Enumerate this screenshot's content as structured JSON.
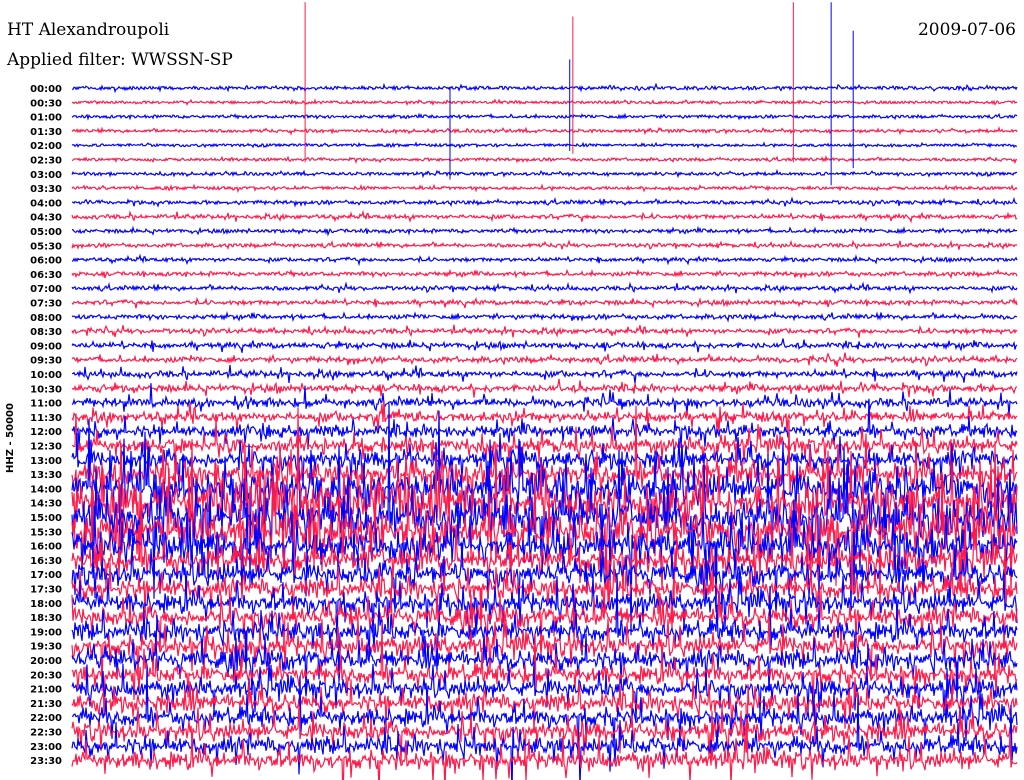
{
  "header": {
    "station": "HT Alexandroupoli",
    "filter_label": "Applied filter: WWSSN-SP",
    "date": "2009-07-06"
  },
  "chart_data": {
    "type": "line",
    "subtype": "helicorder",
    "title": "HT Alexandroupoli",
    "ylabel": "HHZ - 50000",
    "minutes_per_row": 30,
    "colors": {
      "even_row": "#0000ff",
      "odd_row": "#ff1a4a"
    },
    "rows": [
      {
        "label": "00:00",
        "activity": 0.04
      },
      {
        "label": "00:30",
        "activity": 0.02
      },
      {
        "label": "01:00",
        "activity": 0.03
      },
      {
        "label": "01:30",
        "activity": 0.03
      },
      {
        "label": "02:00",
        "activity": 0.02
      },
      {
        "label": "02:30",
        "activity": 0.03
      },
      {
        "label": "03:00",
        "activity": 0.03
      },
      {
        "label": "03:30",
        "activity": 0.03
      },
      {
        "label": "04:00",
        "activity": 0.05
      },
      {
        "label": "04:30",
        "activity": 0.06
      },
      {
        "label": "05:00",
        "activity": 0.05
      },
      {
        "label": "05:30",
        "activity": 0.05
      },
      {
        "label": "06:00",
        "activity": 0.05
      },
      {
        "label": "06:30",
        "activity": 0.06
      },
      {
        "label": "07:00",
        "activity": 0.06
      },
      {
        "label": "07:30",
        "activity": 0.07
      },
      {
        "label": "08:00",
        "activity": 0.07
      },
      {
        "label": "08:30",
        "activity": 0.08
      },
      {
        "label": "09:00",
        "activity": 0.1
      },
      {
        "label": "09:30",
        "activity": 0.1
      },
      {
        "label": "10:00",
        "activity": 0.12
      },
      {
        "label": "10:30",
        "activity": 0.14
      },
      {
        "label": "11:00",
        "activity": 0.18
      },
      {
        "label": "11:30",
        "activity": 0.22
      },
      {
        "label": "12:00",
        "activity": 0.28
      },
      {
        "label": "12:30",
        "activity": 0.35
      },
      {
        "label": "13:00",
        "activity": 0.45
      },
      {
        "label": "13:30",
        "activity": 0.6
      },
      {
        "label": "14:00",
        "activity": 0.8
      },
      {
        "label": "14:30",
        "activity": 1.0
      },
      {
        "label": "15:00",
        "activity": 1.0
      },
      {
        "label": "15:30",
        "activity": 0.95
      },
      {
        "label": "16:00",
        "activity": 0.8
      },
      {
        "label": "16:30",
        "activity": 0.6
      },
      {
        "label": "17:00",
        "activity": 0.55
      },
      {
        "label": "17:30",
        "activity": 0.5
      },
      {
        "label": "18:00",
        "activity": 0.5
      },
      {
        "label": "18:30",
        "activity": 0.5
      },
      {
        "label": "19:00",
        "activity": 0.5
      },
      {
        "label": "19:30",
        "activity": 0.5
      },
      {
        "label": "20:00",
        "activity": 0.5
      },
      {
        "label": "20:30",
        "activity": 0.45
      },
      {
        "label": "21:00",
        "activity": 0.45
      },
      {
        "label": "21:30",
        "activity": 0.45
      },
      {
        "label": "22:00",
        "activity": 0.45
      },
      {
        "label": "22:30",
        "activity": 0.45
      },
      {
        "label": "23:00",
        "activity": 0.45
      },
      {
        "label": "23:30",
        "activity": 0.45
      }
    ],
    "events": [
      {
        "row": 1,
        "minute": 7.4,
        "amplitude": 7
      },
      {
        "row": 4,
        "minute": 12.0,
        "amplitude": 4
      },
      {
        "row": 2,
        "minute": 15.8,
        "amplitude": 4
      },
      {
        "row": 1,
        "minute": 15.9,
        "amplitude": 6
      },
      {
        "row": 1,
        "minute": 22.9,
        "amplitude": 7
      },
      {
        "row": 2,
        "minute": 24.1,
        "amplitude": 8
      },
      {
        "row": 2,
        "minute": 24.8,
        "amplitude": 6
      }
    ]
  }
}
